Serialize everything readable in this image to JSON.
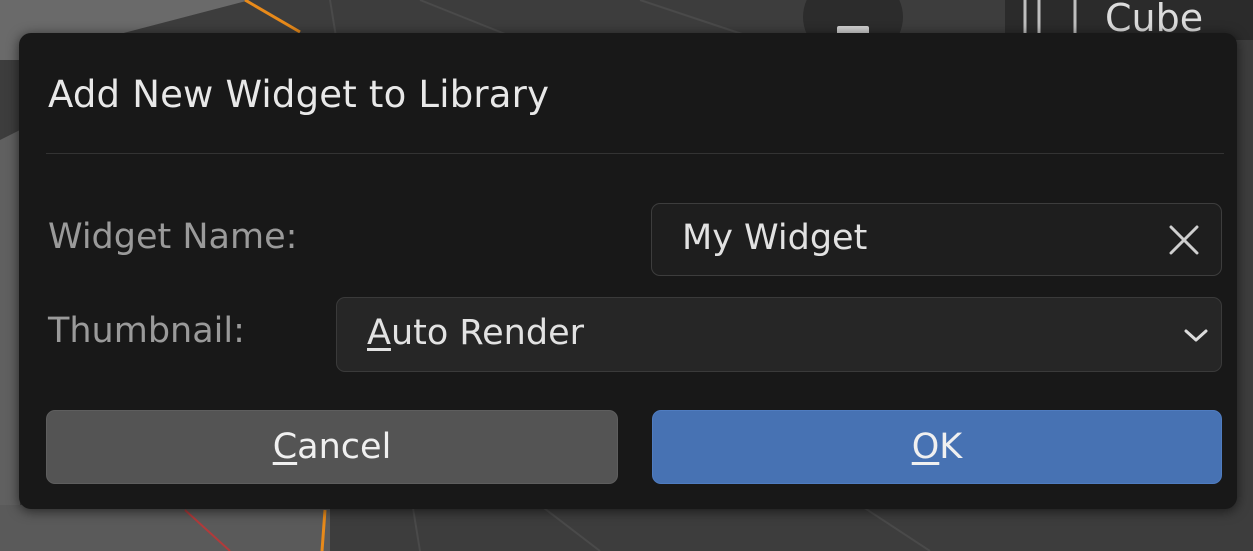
{
  "background": {
    "outliner_item_label": "Cube"
  },
  "dialog": {
    "title": "Add New Widget to Library",
    "widget_name": {
      "label": "Widget Name:",
      "value": "My Widget",
      "clear_icon": "close-icon"
    },
    "thumbnail": {
      "label": "Thumbnail:",
      "selected_first": "A",
      "selected_rest": "uto Render",
      "chevron_icon": "chevron-down-icon"
    },
    "buttons": {
      "cancel_first": "C",
      "cancel_rest": "ancel",
      "ok_first": "O",
      "ok_rest": "K"
    }
  },
  "colors": {
    "dialog_bg": "#181818",
    "ok_button": "#4772b3",
    "cancel_button": "#545454",
    "selection_outline": "#e88a1a"
  }
}
